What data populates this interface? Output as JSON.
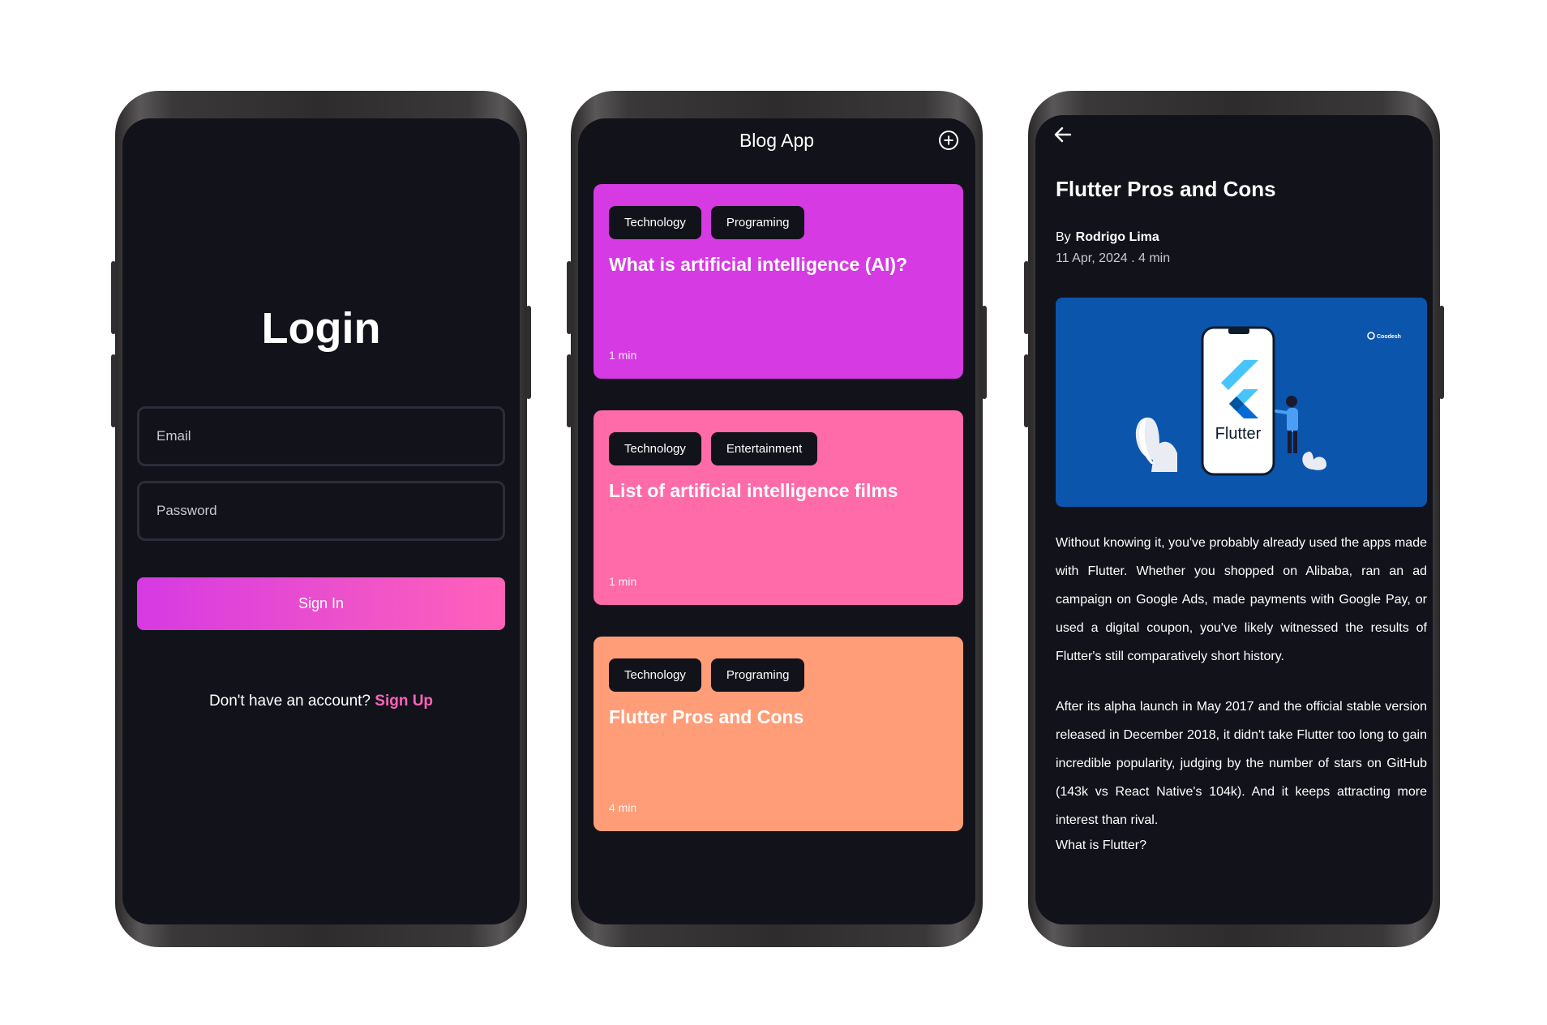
{
  "login": {
    "title": "Login",
    "email_placeholder": "Email",
    "password_placeholder": "Password",
    "signin_label": "Sign In",
    "no_account_text": "Don't have an account?",
    "signup_link": "Sign Up"
  },
  "blog": {
    "title": "Blog App",
    "add_icon": "add-circle-icon",
    "posts": [
      {
        "tags": [
          "Technology",
          "Programing"
        ],
        "title": "What is artificial intelligence (AI)?",
        "time": "1 min",
        "color": "#d63ae3"
      },
      {
        "tags": [
          "Technology",
          "Entertainment"
        ],
        "title": "List of artificial intelligence films",
        "time": "1 min",
        "color": "#ff6aa8"
      },
      {
        "tags": [
          "Technology",
          "Programing"
        ],
        "title": "Flutter Pros and Cons",
        "time": "4 min",
        "color": "#ff9d78"
      }
    ]
  },
  "detail": {
    "back_icon": "arrow-left-icon",
    "title": "Flutter Pros and Cons",
    "by_label": "By",
    "author": "Rodrigo Lima",
    "date_and_read_time": "11 Apr, 2024 . 4 min",
    "hero_text": "Flutter",
    "hero_brand": "Coodesh",
    "paragraphs": [
      "Without knowing it, you've probably already used the apps made with Flutter. Whether you shopped on Alibaba, ran an ad campaign on Google Ads, made payments with Google Pay, or used a digital coupon, you've likely witnessed the results of Flutter's still comparatively short history.",
      "After its alpha launch in May 2017 and the official stable version released in December 2018, it didn't take Flutter too long to gain incredible popularity, judging by the number of stars on GitHub (143k vs React Native's 104k). And it keeps attracting more interest than rival.",
      "What is Flutter?"
    ]
  },
  "colors": {
    "screen_bg": "#12121a",
    "accent_pink": "#ff62b8",
    "accent_purple": "#d63ae3",
    "hero_blue": "#0b55ad"
  }
}
